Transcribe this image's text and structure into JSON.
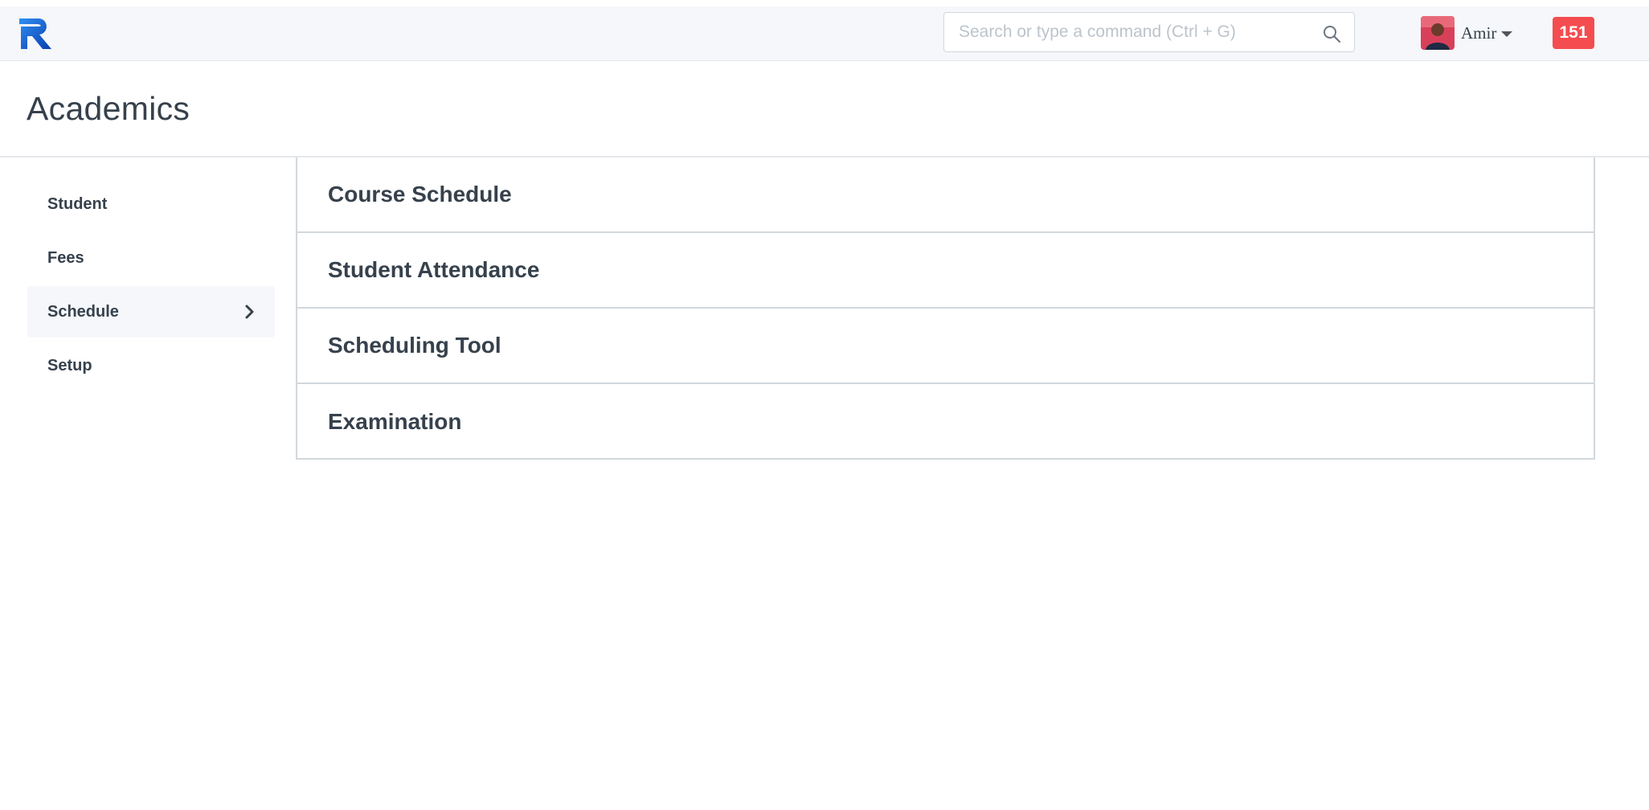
{
  "brand": {
    "accent": "#1a73e8",
    "icon": "r-logo-icon"
  },
  "search": {
    "placeholder": "Search or type a command (Ctrl + G)",
    "value": ""
  },
  "user": {
    "name": "Amir",
    "avatar": "avatar-photo"
  },
  "notifications": {
    "count": "151",
    "color": "#f44c4f"
  },
  "page": {
    "title": "Academics"
  },
  "sidebar": {
    "items": [
      {
        "label": "Student",
        "active": false
      },
      {
        "label": "Fees",
        "active": false
      },
      {
        "label": "Schedule",
        "active": true
      },
      {
        "label": "Setup",
        "active": false
      }
    ]
  },
  "main": {
    "sections": [
      {
        "label": "Course Schedule"
      },
      {
        "label": "Student Attendance"
      },
      {
        "label": "Scheduling Tool"
      },
      {
        "label": "Examination"
      }
    ]
  }
}
